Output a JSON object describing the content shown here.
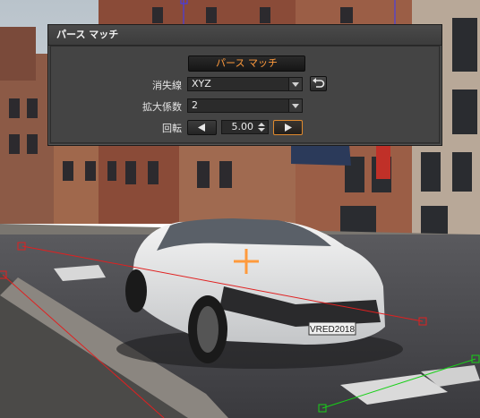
{
  "panel": {
    "title": "パース マッチ",
    "match_button_label": "パース マッチ",
    "vanishing_line": {
      "label": "消失線",
      "value": "XYZ"
    },
    "scale_factor": {
      "label": "拡大係数",
      "value": "2"
    },
    "rotation": {
      "label": "回転",
      "value": "5.00"
    }
  },
  "scene": {
    "license_plate": "VRED2018",
    "red_guide_color": "#e02020",
    "green_guide_color": "#18d018",
    "accent_color": "#ff9a3c"
  },
  "icons": [
    "reset-arrow-icon",
    "chevron-down-icon",
    "left-arrow-icon",
    "right-arrow-icon",
    "spin-updown-icon",
    "crosshair-icon"
  ]
}
